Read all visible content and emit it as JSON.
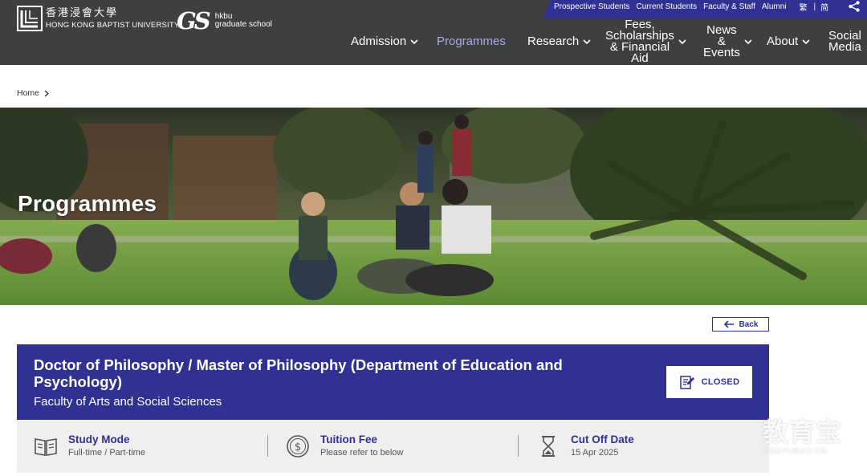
{
  "top_bar": {
    "links": [
      "Prospective Students",
      "Current Students",
      "Faculty & Staff",
      "Alumni"
    ],
    "lang_trad": "繁",
    "lang_simp": "简"
  },
  "logo": {
    "name_cn": "香港浸會大學",
    "name_en": "HONG KONG BAPTIST UNIVERSITY"
  },
  "gs_logo": {
    "mark": "GS",
    "line1": "hkbu",
    "line2": "graduate school"
  },
  "nav": {
    "admission": "Admission",
    "programmes": "Programmes",
    "research": "Research",
    "fees_l1": "Fees,",
    "fees_l2": "Scholarships",
    "fees_l3": "& Financial",
    "fees_l4": "Aid",
    "news_l1": "News",
    "news_l2": "&",
    "news_l3": "Events",
    "about": "About",
    "social_l1": "Social",
    "social_l2": "Media"
  },
  "breadcrumb": {
    "home": "Home"
  },
  "hero": {
    "title": "Programmes"
  },
  "back_button": {
    "label": "Back"
  },
  "programme": {
    "title": "Doctor of Philosophy / Master of Philosophy (Department of Education and Psychology)",
    "faculty": "Faculty of Arts and Social Sciences",
    "status": "CLOSED"
  },
  "info": {
    "study_mode": {
      "label": "Study Mode",
      "value": "Full-time / Part-time"
    },
    "tuition_fee": {
      "label": "Tuition Fee",
      "value": "Please refer to below"
    },
    "cut_off_date": {
      "label": "Cut Off Date",
      "value": "15 Apr 2025"
    }
  },
  "watermark": {
    "cn": "教育宝",
    "en": "JIAOYUBAO.CN"
  },
  "colors": {
    "primary": "#2f3193",
    "header": "#3f3f3f",
    "nav_active": "#a7a9e8",
    "info_bg": "#efefef"
  }
}
